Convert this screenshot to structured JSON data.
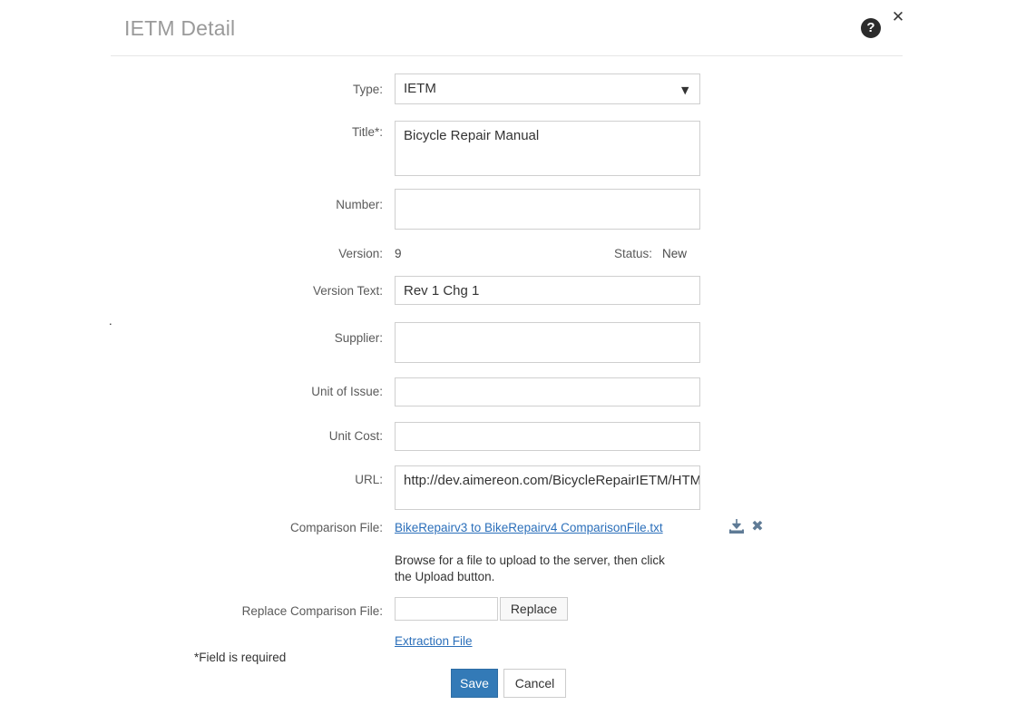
{
  "header": {
    "title": "IETM Detail",
    "help_icon": "help-circle-icon",
    "help_glyph": "?",
    "close_icon": "close-icon",
    "close_glyph": "✕"
  },
  "stray_mark": ".",
  "form": {
    "type": {
      "label": "Type:",
      "value": "IETM",
      "arrow": "▼"
    },
    "title": {
      "label": "Title*:",
      "value": "Bicycle Repair Manual",
      "placeholder": ""
    },
    "number": {
      "label": "Number:",
      "value": "",
      "placeholder": ""
    },
    "version": {
      "label": "Version:",
      "value": "9"
    },
    "status": {
      "label": "Status:",
      "value": "New"
    },
    "version_text": {
      "label": "Version Text:",
      "value": "Rev 1 Chg 1",
      "placeholder": ""
    },
    "supplier": {
      "label": "Supplier:",
      "value": "",
      "placeholder": ""
    },
    "unit_of_issue": {
      "label": "Unit of Issue:",
      "value": "",
      "placeholder": ""
    },
    "unit_cost": {
      "label": "Unit Cost:",
      "value": "",
      "placeholder": ""
    },
    "url": {
      "label": "URL:",
      "value": "http://dev.aimereon.com/BicycleRepairIETM/HTML",
      "placeholder": ""
    },
    "comparison_file": {
      "label": "Comparison File:",
      "link_text": "BikeRepairv3 to BikeRepairv4 ComparisonFile.txt",
      "download_icon": "download-icon",
      "delete_icon": "delete-x-icon",
      "delete_glyph": "✖",
      "help_text": "Browse for a file to upload to the server, then click the Upload button."
    },
    "replace_comparison_file": {
      "label": "Replace Comparison File:",
      "value": "",
      "placeholder": "",
      "button_label": "Replace"
    },
    "extraction_file_link": "Extraction File",
    "required_note": "*Field is required"
  },
  "actions": {
    "save_label": "Save",
    "cancel_label": "Cancel"
  },
  "colors": {
    "primary": "#337ab7",
    "link": "#2b6fba",
    "title_gray": "#9a9a9a",
    "border": "#cfcfcf"
  }
}
